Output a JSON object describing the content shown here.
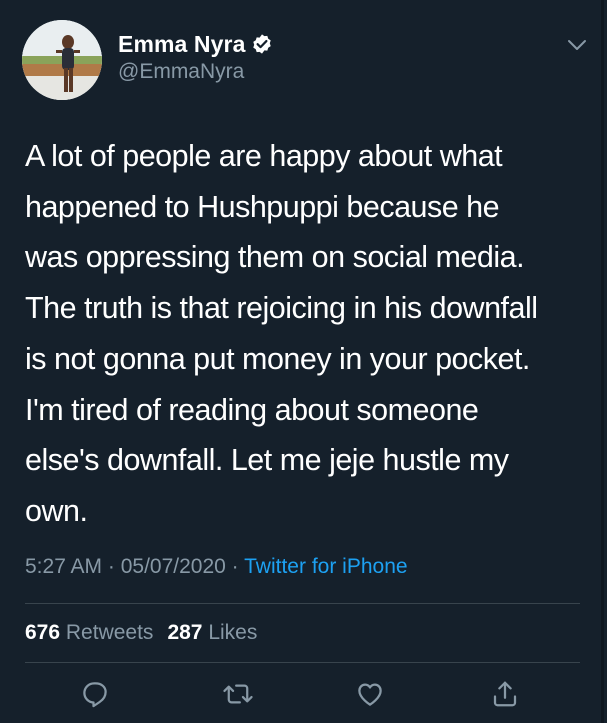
{
  "header": {
    "display_name": "Emma Nyra",
    "handle": "@EmmaNyra",
    "verified": true
  },
  "tweet": {
    "text": "A lot of people are happy about what happened to Hushpuppi because he was oppressing them on social media. The truth is that rejoicing in his downfall is not gonna put money in your pocket. I'm tired of reading about someone else's downfall. Let me jeje hustle my own.",
    "lines": [
      "A lot of people are happy about what",
      "happened to Hushpuppi because he",
      "was oppressing them on social media.",
      "The truth is that rejoicing in his downfall",
      "is not gonna put money in your pocket.",
      "I'm tired of reading about someone",
      "else's downfall. Let me jeje hustle my",
      "own."
    ]
  },
  "meta": {
    "time": "5:27 AM",
    "sep1": " · ",
    "date": "05/07/2020",
    "sep2": " · ",
    "source": "Twitter for iPhone"
  },
  "stats": {
    "retweets_count": "676",
    "retweets_label": "Retweets",
    "likes_count": "287",
    "likes_label": "Likes"
  },
  "icons": {
    "verified": "verified-badge-icon",
    "more": "chevron-down-icon",
    "reply": "reply-icon",
    "retweet": "retweet-icon",
    "like": "heart-icon",
    "share": "share-icon"
  },
  "colors": {
    "background": "#15202b",
    "text": "#ffffff",
    "secondary": "#8899a6",
    "link": "#1da1f2",
    "divider": "#38444d"
  }
}
